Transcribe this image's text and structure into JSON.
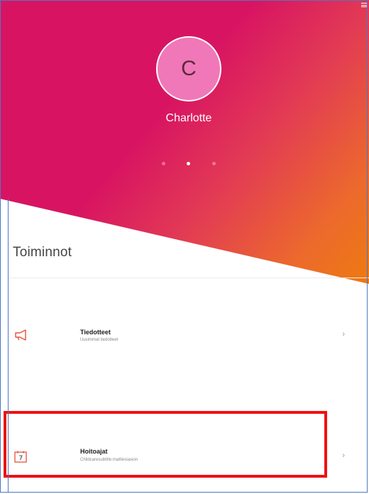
{
  "profile": {
    "avatar_initial": "C",
    "name": "Charlotte"
  },
  "pager": {
    "count": 3,
    "active_index": 1
  },
  "section": {
    "title": "Toiminnot"
  },
  "list": {
    "items": [
      {
        "title": "Tiedotteet",
        "subtitle": "Uusimmat tiedotteet",
        "icon": "megaphone-icon"
      },
      {
        "title": "Hoitoajat",
        "subtitle": "Childcaresubtitle:mattiesiasion",
        "icon": "calendar-icon"
      }
    ]
  },
  "colors": {
    "gradient_start": "#d81462",
    "gradient_end": "#ee7a10",
    "avatar_fill": "#f078b8",
    "icon_accent": "#e5533a",
    "highlight_border": "#ee1111",
    "frame_border": "#4a78c4"
  }
}
